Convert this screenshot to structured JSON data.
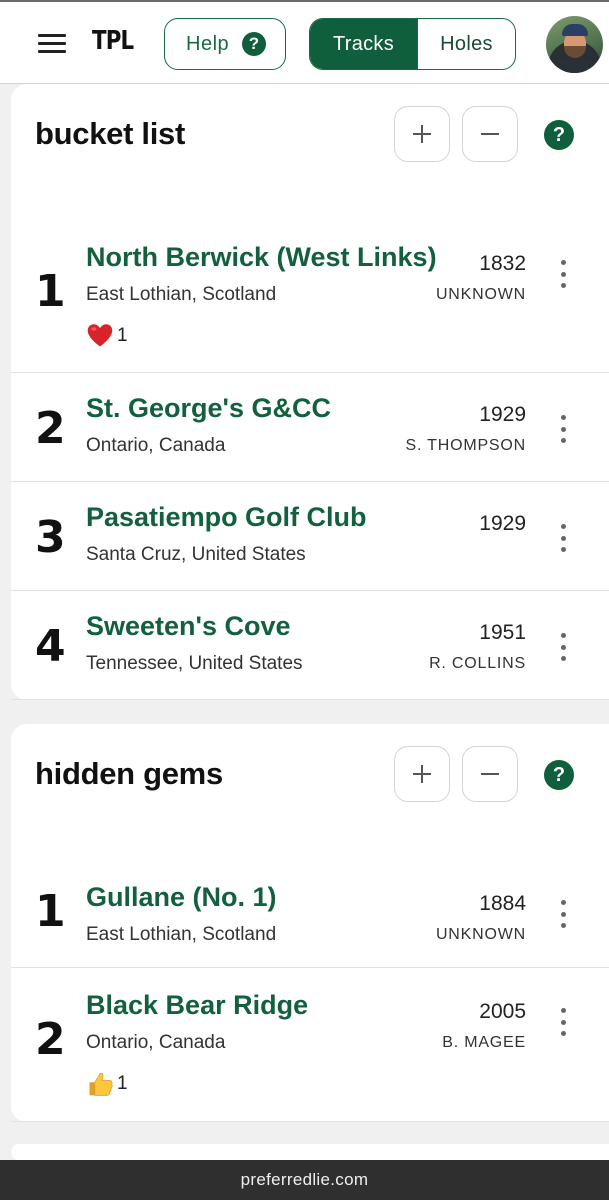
{
  "header": {
    "logo": "TPL",
    "help_label": "Help",
    "help_icon": "?",
    "tabs": [
      {
        "label": "Tracks",
        "active": true
      },
      {
        "label": "Holes",
        "active": false
      }
    ]
  },
  "lists": [
    {
      "title": "bucket list",
      "help_icon": "?",
      "items": [
        {
          "rank": "1",
          "name": "North Berwick (West Links)",
          "location": "East Lothian, Scotland",
          "year": "1832",
          "architect": "UNKNOWN",
          "reaction": {
            "icon": "heart-icon",
            "count": "1"
          }
        },
        {
          "rank": "2",
          "name": "St. George's G&CC",
          "location": "Ontario, Canada",
          "year": "1929",
          "architect": "S. THOMPSON"
        },
        {
          "rank": "3",
          "name": "Pasatiempo Golf Club",
          "location": "Santa Cruz, United States",
          "year": "1929",
          "architect": ""
        },
        {
          "rank": "4",
          "name": "Sweeten's Cove",
          "location": "Tennessee, United States",
          "year": "1951",
          "architect": "R. COLLINS"
        }
      ]
    },
    {
      "title": "hidden gems",
      "help_icon": "?",
      "items": [
        {
          "rank": "1",
          "name": "Gullane (No. 1)",
          "location": "East Lothian, Scotland",
          "year": "1884",
          "architect": "UNKNOWN"
        },
        {
          "rank": "2",
          "name": "Black Bear Ridge",
          "location": "Ontario, Canada",
          "year": "2005",
          "architect": "B. MAGEE",
          "reaction": {
            "icon": "thumbs-up-icon",
            "count": "1"
          }
        }
      ]
    }
  ],
  "footer": {
    "text": "preferredlie.com"
  },
  "colors": {
    "accent": "#0f5e3c",
    "course_name": "#12603d",
    "footer_bg": "#2f2f2f",
    "page_bg": "#f0f0f0"
  }
}
